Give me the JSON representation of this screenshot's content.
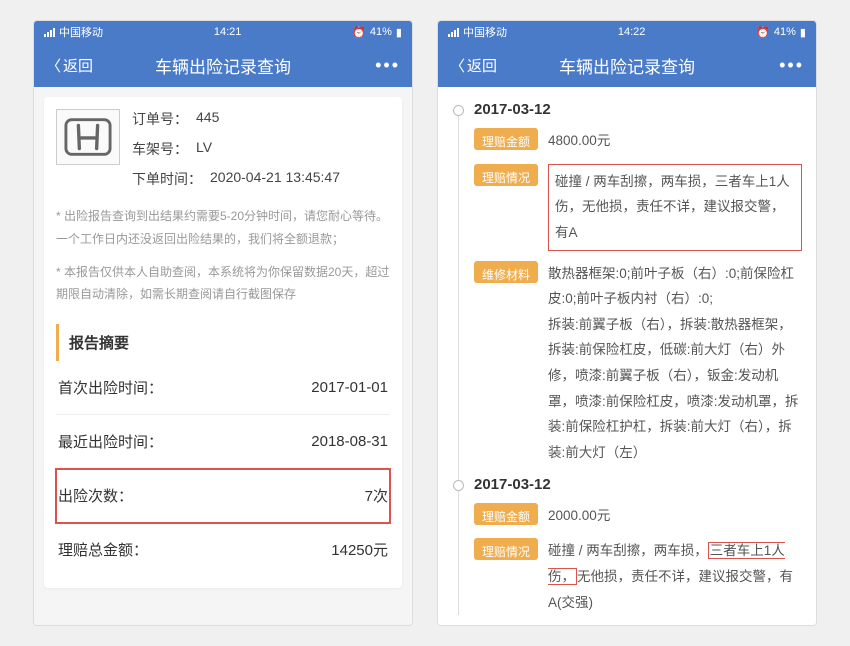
{
  "statusbar": {
    "carrier": "中国移动",
    "time_left": "14:21",
    "time_right": "14:22",
    "battery": "41%"
  },
  "nav": {
    "back": "返回",
    "title": "车辆出险记录查询",
    "more": "•••"
  },
  "order": {
    "order_no_label": "订单号：",
    "order_no_value": "445",
    "vin_label": "车架号：",
    "vin_value": "LV",
    "time_label": "下单时间：",
    "time_value": "2020-04-21 13:45:47"
  },
  "notes": {
    "n1": "* 出险报告查询到出结果约需要5-20分钟时间，请您耐心等待。一个工作日内还没返回出险结果的，我们将全额退款；",
    "n2": "* 本报告仅供本人自助查阅，本系统将为你保留数据20天，超过期限自动清除，如需长期查阅请自行截图保存"
  },
  "summary": {
    "title": "报告摘要",
    "first_label": "首次出险时间：",
    "first_value": "2017-01-01",
    "last_label": "最近出险时间：",
    "last_value": "2018-08-31",
    "count_label": "出险次数：",
    "count_value": "7次",
    "total_label": "理赔总金额：",
    "total_value": "14250元"
  },
  "events": [
    {
      "date": "2017-03-12",
      "amount_label": "理赔金额",
      "amount_value": "4800.00元",
      "situation_label": "理赔情况",
      "situation_value": "碰撞 / 两车刮擦，两车损，三者车上1人伤，无他损，责任不详，建议报交警，有A",
      "material_label": "维修材料",
      "material_value": "散热器框架:0;前叶子板（右）:0;前保险杠皮:0;前叶子板内衬（右）:0;\n拆装:前翼子板（右），拆装:散热器框架，拆装:前保险杠皮，低碳:前大灯（右）外修，喷漆:前翼子板（右），钣金:发动机罩，喷漆:前保险杠皮，喷漆:发动机罩，拆装:前保险杠护杠，拆装:前大灯（右），拆装:前大灯（左）"
    },
    {
      "date": "2017-03-12",
      "amount_label": "理赔金额",
      "amount_value": "2000.00元",
      "situation_label": "理赔情况",
      "situation_prefix": "碰撞 / 两车刮擦，两车损，",
      "situation_boxed": "三者车上1人伤，",
      "situation_suffix": "无他损，责任不详，建议报交警，有A(交强)"
    }
  ]
}
